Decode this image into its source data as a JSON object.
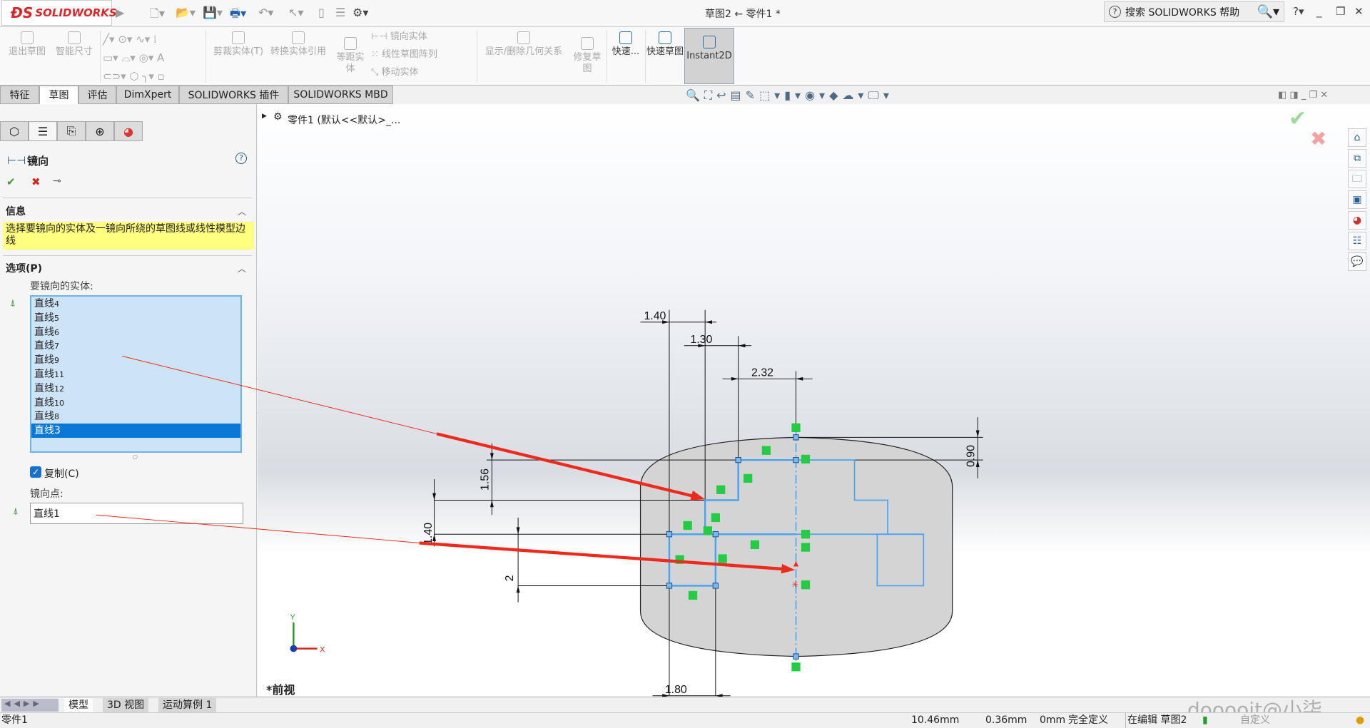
{
  "app": {
    "logo": "SOLIDWORKS",
    "window_title": "草图2 ← 零件1 *",
    "search_placeholder": "搜索 SOLIDWORKS 帮助",
    "help": "?"
  },
  "ribbon": {
    "items": [
      "退出草图",
      "智能尺寸",
      "剪裁实体(T)",
      "转换实体引用",
      "等距实体",
      "镜向实体",
      "线性草图阵列",
      "移动实体",
      "显示/删除几何关系",
      "修复草图",
      "快速...",
      "快速草图",
      "Instant2D"
    ]
  },
  "tabs": [
    "特征",
    "草图",
    "评估",
    "DimXpert",
    "SOLIDWORKS 插件",
    "SOLIDWORKS MBD"
  ],
  "active_tab": "草图",
  "panel": {
    "title": "镜向",
    "info_header": "信息",
    "info_text": "选择要镜向的实体及一镜向所绕的草图线或线性模型边线",
    "options_header": "选项(P)",
    "entities_label": "要镜向的实体:",
    "entities": [
      {
        "name": "直线",
        "n": "4"
      },
      {
        "name": "直线",
        "n": "5"
      },
      {
        "name": "直线",
        "n": "6"
      },
      {
        "name": "直线",
        "n": "7"
      },
      {
        "name": "直线",
        "n": "9"
      },
      {
        "name": "直线",
        "n": "11"
      },
      {
        "name": "直线",
        "n": "12"
      },
      {
        "name": "直线",
        "n": "10"
      },
      {
        "name": "直线",
        "n": "8"
      },
      {
        "name": "直线",
        "n": "3"
      }
    ],
    "selected_entity": "直线3",
    "copy_label": "复制(C)",
    "copy_checked": true,
    "mirror_point_label": "镜向点:",
    "mirror_point_value": "直线1"
  },
  "viewport": {
    "tree_item": "零件1 (默认<<默认>_...",
    "view_name": "*前视",
    "watermark": "dooooit@小柒",
    "dimensions": {
      "d1": "1.40",
      "d2": "1.30",
      "d3": "2.32",
      "d4": "0.90",
      "d5": "1.56",
      "d6": "1.40",
      "d7": "2",
      "d8": "1.80"
    },
    "axis_x": "X",
    "axis_y": "Y"
  },
  "bottom_tabs": [
    "模型",
    "3D 视图",
    "运动算例 1"
  ],
  "status": {
    "doc": "零件1",
    "x": "10.46mm",
    "y": "0.36mm",
    "z": "0mm",
    "state": "完全定义",
    "mode": "在编辑 草图2",
    "custom": "自定义"
  },
  "colors": {
    "sketch": "#4aa3f0",
    "arrow": "#ee2a1c",
    "relation": "#22cc44",
    "info_bg": "#ffff80",
    "selection": "#0a78d7"
  }
}
